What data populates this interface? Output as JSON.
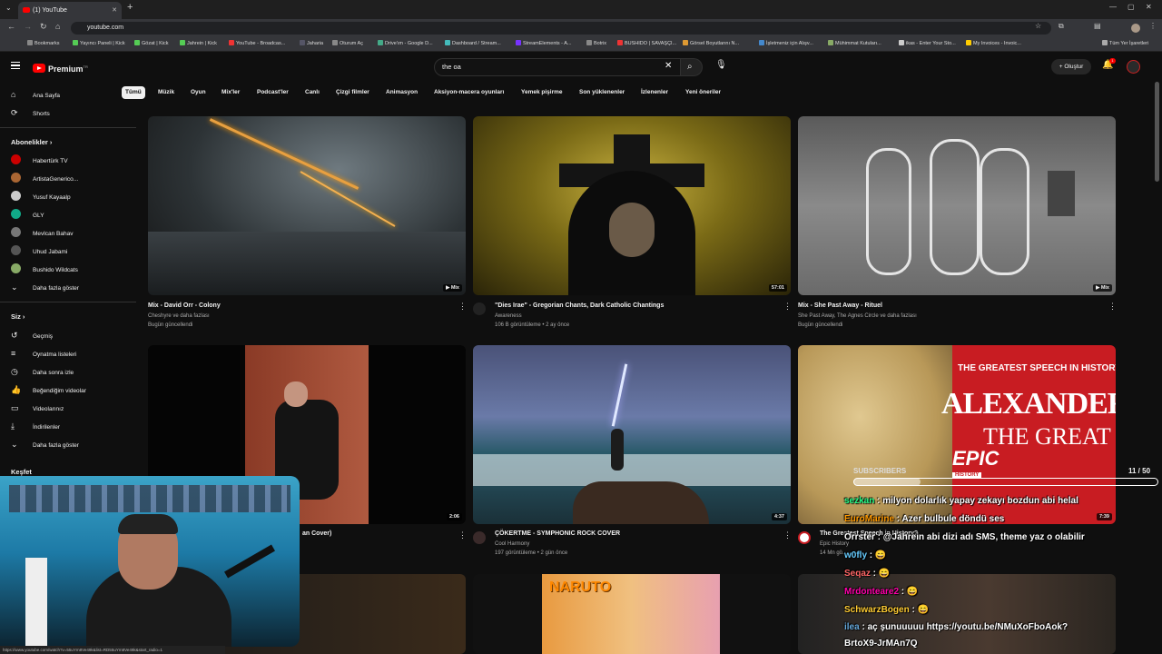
{
  "browser": {
    "tab_title": "(1) YouTube",
    "url": "youtube.com",
    "bookmarks": [
      "Bookmarks",
      "Yayıncı Paneli | Kick",
      "Gözat | Kick",
      "Jahrein | Kick",
      "YouTube - Broadcas...",
      "Jaharia",
      "Oturum Aç",
      "Drive'ım - Google D...",
      "Dashboard / Stream...",
      "StreamElements - A...",
      "Botrix",
      "BUSHIDO | SAVAŞÇI...",
      "Görsel Boyutlarını N...",
      "İşletmeniz için Alışv...",
      "Mühimmat Kutuları...",
      "ikas - Enter Your Sto...",
      "My Invoices - Invoic...",
      "Tüm Yer İşaretleri"
    ]
  },
  "header": {
    "logo": "Premium",
    "logo_sup": "TR",
    "search_value": "the oa",
    "create_label": "Oluştur",
    "notif_count": "1"
  },
  "chips": [
    "Tümü",
    "Müzik",
    "Oyun",
    "Mix'ler",
    "Podcast'ler",
    "Canlı",
    "Çizgi filmler",
    "Animasyon",
    "Aksiyon-macera oyunları",
    "Yemek pişirme",
    "Son yüklenenler",
    "İzlenenler",
    "Yeni öneriler"
  ],
  "sidebar": {
    "main": [
      {
        "icon": "⌂",
        "label": "Ana Sayfa"
      },
      {
        "icon": "⟳",
        "label": "Shorts"
      }
    ],
    "subs_heading": "Abonelikler",
    "subs": [
      {
        "label": "Habertürk TV",
        "color": "#c00"
      },
      {
        "label": "ArtistaGenerico...",
        "color": "#a63"
      },
      {
        "label": "Yusuf Kayaalp",
        "color": "#ccc"
      },
      {
        "label": "GLY",
        "color": "#1a8"
      },
      {
        "label": "Mevlcan Bahav",
        "color": "#777"
      },
      {
        "label": "Uhud Jabami",
        "color": "#555"
      },
      {
        "label": "Bushido Wildcats",
        "color": "#8a6"
      }
    ],
    "subs_more": "Daha fazla göster",
    "you_heading": "Siz",
    "you": [
      {
        "icon": "↺",
        "label": "Geçmiş"
      },
      {
        "icon": "≡",
        "label": "Oynatma listeleri"
      },
      {
        "icon": "◷",
        "label": "Daha sonra izle"
      },
      {
        "icon": "👍",
        "label": "Beğendiğim videolar"
      },
      {
        "icon": "▭",
        "label": "Videolarınız"
      },
      {
        "icon": "⤓",
        "label": "İndirilenler"
      }
    ],
    "you_more": "Daha fazla göster",
    "explore_heading": "Keşfet"
  },
  "videos": [
    {
      "title": "Mix - David Orr - Colony",
      "line1": "Cheshyre ve daha fazlası",
      "line2": "Bugün güncellendi",
      "badge": "▶ Mix"
    },
    {
      "title": "\"Dies Irae\" - Gregorian Chants,  Dark Catholic Chantings",
      "line1": "Awareness",
      "line2": "106 B görüntüleme • 2 ay önce",
      "badge": "57:01"
    },
    {
      "title": "Mix - She Past Away - Rituel",
      "line1": "She Past Away, The Agnes Circle ve daha fazlası",
      "line2": "Bugün güncellendi",
      "badge": "▶ Mix"
    },
    {
      "title": "an Cover)",
      "line1": "",
      "line2": "",
      "badge": "2:06"
    },
    {
      "title": "ÇÖKERTME - SYMPHONIC ROCK COVER",
      "line1": "Cool Harmony",
      "line2": "197 görüntüleme • 2 gün önce",
      "badge": "4:37"
    },
    {
      "title": "The Greatest Speech in History?",
      "line1": "Epic History",
      "line2": "14 Mn gö...",
      "badge": "7:39"
    }
  ],
  "thumb_text": {
    "greatest": "THE GREATEST SPEECH IN HISTORY?",
    "alexander": "ALEXANDER",
    "the_great": "THE GREAT",
    "epic": "EPIC",
    "history": "HISTORY",
    "naruto": "NARUTO"
  },
  "overlay": {
    "subs_label": "SUBSCRIBERS",
    "subs_count": "11 / 50",
    "subs_progress": 0.22,
    "chat": [
      {
        "user": "sezkan",
        "msg": " : milyon dolarlık yapay zekayı bozdun abi helal",
        "color": "#2f8"
      },
      {
        "user": "EuroMarine",
        "msg": " : Azer bulbule döndü ses",
        "color": "#f90"
      },
      {
        "user": "Orrster",
        "msg": " : @Jahrein abi dizi adı SMS, theme yaz o olabilir",
        "color": "#fff"
      },
      {
        "user": "w0fly",
        "msg": " : 😄",
        "color": "#6cf"
      },
      {
        "user": "Seqaz",
        "msg": " : 😄",
        "color": "#f66"
      },
      {
        "user": "Mrdonteare2",
        "msg": " : 😄",
        "color": "#f0a"
      },
      {
        "user": "SchwarzBogen",
        "msg": " : 😄",
        "color": "#fc3"
      },
      {
        "user": "ilea",
        "msg": " : aç şunuuuuu https://youtu.be/NMuXoFboAok?",
        "color": "#6ad"
      },
      {
        "user": "",
        "msg": "BrtoX9-JrMAn7Q",
        "color": "#fff"
      }
    ]
  },
  "status_url": "https://www.youtube.com/watch?v=55uYm8Ve49k&list=RD55uYm8Ve49k&start_radio=1"
}
